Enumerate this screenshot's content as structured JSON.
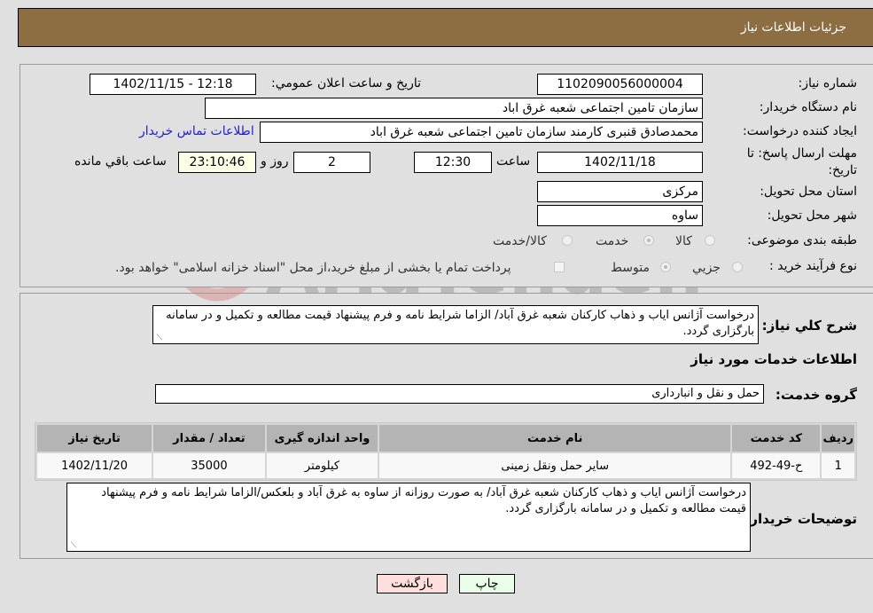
{
  "header": {
    "title": "جزئیات اطلاعات نیاز"
  },
  "fields": {
    "need_number": {
      "label": "شماره نیاز:",
      "value": "1102090056000004"
    },
    "announce_datetime": {
      "label": "تاریخ و ساعت اعلان عمومي:",
      "value": "1402/11/15 - 12:18"
    },
    "buyer_org": {
      "label": "نام دستگاه خریدار:",
      "value": "سازمان تامین اجتماعی شعبه غرق اباد"
    },
    "creator": {
      "label": "ایجاد کننده درخواست:",
      "value": "محمدصادق قنبری کارمند سازمان تامین اجتماعی شعبه غرق اباد"
    },
    "buyer_contact_link": "اطلاعات تماس خریدار",
    "deadline": {
      "label": "مهلت ارسال پاسخ: تا تاریخ:",
      "date": "1402/11/18",
      "time_label": "ساعت",
      "time": "12:30",
      "days": "2",
      "days_label": "روز و",
      "remaining": "23:10:46",
      "remaining_label": "ساعت باقي مانده"
    },
    "province": {
      "label": "استان محل تحویل:",
      "value": "مرکزی"
    },
    "city": {
      "label": "شهر محل تحویل:",
      "value": "ساوه"
    },
    "category": {
      "label": "طبقه بندی موضوعی:",
      "options": [
        "کالا",
        "خدمت",
        "کالا/خدمت"
      ],
      "selected": "خدمت"
    },
    "purchase_type": {
      "label": "نوع فرآیند خرید :",
      "options": [
        "جزيي",
        "متوسط"
      ],
      "selected": "متوسط",
      "treasury_note": "پرداخت تمام یا بخشی از مبلغ خرید،از محل \"اسناد خزانه اسلامی\" خواهد بود."
    }
  },
  "description": {
    "label": "شرح کلي نیاز:",
    "value": "درخواست آژانس ایاب و ذهاب کارکنان شعبه غرق آباد/ الزاما شرایط نامه و فرم پیشنهاد قیمت مطالعه و تکمیل و در سامانه بارگزاری گردد."
  },
  "services_section": {
    "title": "اطلاعات خدمات مورد نیاز",
    "group_label": "گروه خدمت:",
    "group_value": "حمل و نقل و انبارداری"
  },
  "table": {
    "headers": [
      "ردیف",
      "کد خدمت",
      "نام خدمت",
      "واحد اندازه گیری",
      "تعداد / مقدار",
      "تاریخ نیاز"
    ],
    "rows": [
      [
        "1",
        "ح-49-492",
        "سایر حمل ونقل زمینی",
        "کیلومتر",
        "35000",
        "1402/11/20"
      ]
    ]
  },
  "buyer_notes": {
    "label": "توضیحات خریدار:",
    "value": "درخواست آژانس ایاب و ذهاب کارکنان شعبه غرق آباد/ به صورت روزانه از ساوه به غرق آباد و بلعکس/الزاما شرایط نامه و فرم پیشنهاد قیمت مطالعه و تکمیل و در سامانه بارگزاری گردد."
  },
  "buttons": {
    "print": "چاپ",
    "back": "بازگشت"
  },
  "colors": {
    "header": "#8d6e43",
    "print_bg": "#eaffea",
    "back_bg": "#ffdede",
    "link": "#2020d0"
  },
  "watermark": "AriaTender.neT"
}
